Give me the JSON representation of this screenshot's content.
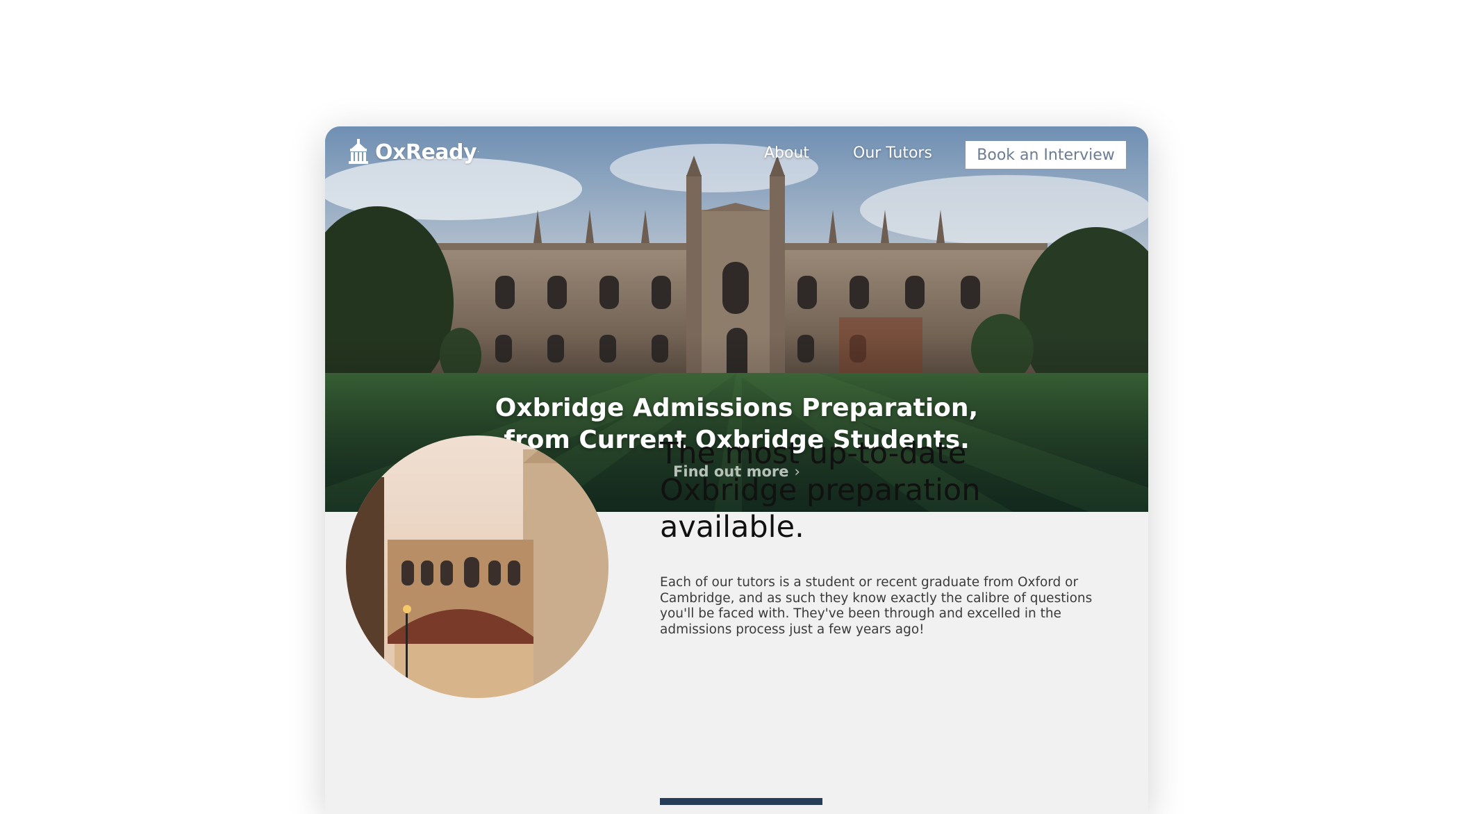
{
  "brand": {
    "name": "OxReady",
    "trademark": "·",
    "icon": "college-building-icon"
  },
  "nav": {
    "about_label": "About",
    "tutors_label": "Our Tutors",
    "cta_label": "Book an Interview"
  },
  "hero": {
    "title_line1": "Oxbridge Admissions Preparation,",
    "title_line2": "from Current Oxbridge Students.",
    "link_label": "Find out more",
    "link_icon": "chevron-right-icon",
    "image": "college-quad-photo"
  },
  "feature": {
    "title_line1": "The most up-to-date",
    "title_line2": "Oxbridge preparation",
    "title_line3": "available.",
    "body": "Each of our tutors is a student or recent graduate from Oxford or Cambridge, and as such they know exactly the calibre of questions you'll be faced with. They've been through and excelled in the admissions process just a few years ago!",
    "image": "bridge-of-sighs-photo"
  },
  "colors": {
    "brand_navy": "#263d5a",
    "cta_text": "#6b7c93",
    "section_bg": "#f1f1f1"
  }
}
